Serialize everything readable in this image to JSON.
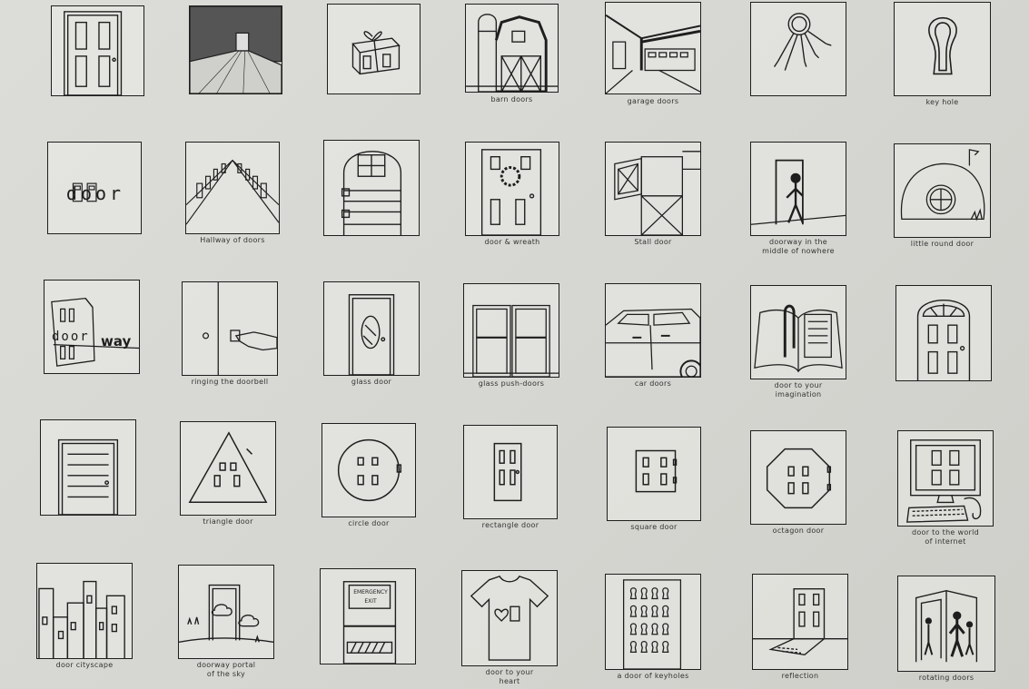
{
  "sheet": {
    "captions": {
      "barn_doors": "barn doors",
      "garage_doors": "garage doors",
      "key_hole": "key hole",
      "hallway_of_doors": "Hallway of doors",
      "door_wreath": "door & wreath",
      "stall_door": "Stall door",
      "doorway_middle": "doorway in the\nmiddle of nowhere",
      "little_round_door": "little round door",
      "ringing_doorbell": "ringing the doorbell",
      "glass_door": "glass door",
      "glass_push_doors": "glass push-doors",
      "car_doors": "car doors",
      "door_imagination": "door to your\nimagination",
      "triangle_door": "triangle door",
      "circle_door": "circle door",
      "rectangle_door": "rectangle door",
      "square_door": "square door",
      "octagon_door": "octagon door",
      "door_internet": "door to the world\nof internet",
      "door_cityscape": "door cityscape",
      "doorway_portal": "doorway portal\nof the sky",
      "door_to_your_heart": "door to your\nheart",
      "door_of_keyholes": "a door of keyholes",
      "reflection": "reflection",
      "rotating_doors": "rotating doors"
    },
    "sketch_text": {
      "door_word": "door",
      "door_prefix": "door",
      "way_suffix": "way",
      "emergency_line1": "EMERGENCY",
      "emergency_line2": "EXIT"
    }
  }
}
